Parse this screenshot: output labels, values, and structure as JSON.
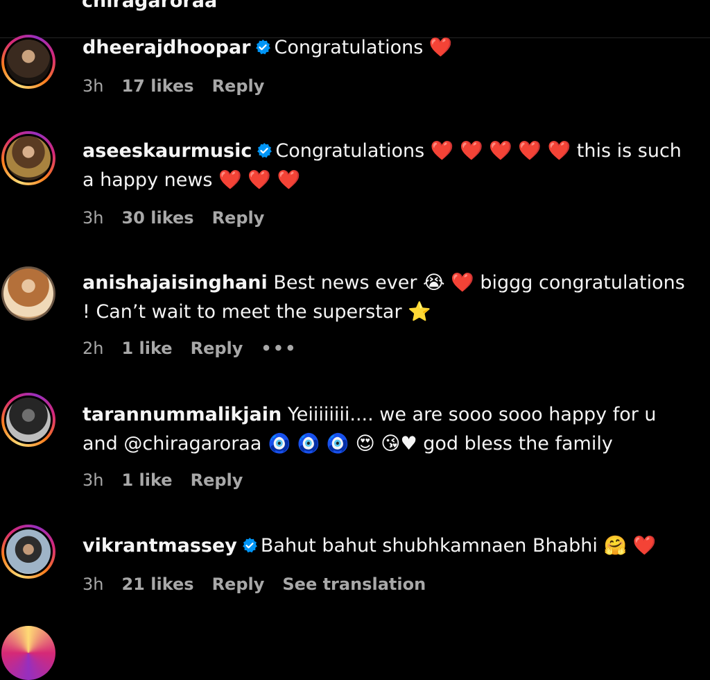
{
  "header": {
    "username": "chiragaroraa"
  },
  "comments": [
    {
      "username": "dheerajdhoopar",
      "text": "Congratulations ❤️",
      "time": "3h",
      "likes": "17 likes",
      "reply": "Reply"
    },
    {
      "username": "aseeskaurmusic",
      "text": "Congratulations ❤️ ❤️ ❤️ ❤️ ❤️  this is such a happy news ❤️ ❤️ ❤️",
      "time": "3h",
      "likes": "30 likes",
      "reply": "Reply"
    },
    {
      "username": "anishajaisinghani",
      "text": "Best news ever 😭 ❤️  biggg congratulations ! Can’t wait to meet the superstar ⭐",
      "time": "2h",
      "likes": "1 like",
      "reply": "Reply",
      "more": "•••"
    },
    {
      "username": "tarannummalikjain",
      "text": "Yeiiiiiiii.... we are sooo sooo happy for u and @chiragaroraa 🧿 🧿 🧿 😍 😘♥ god bless the family",
      "time": "3h",
      "likes": "1 like",
      "reply": "Reply"
    },
    {
      "username": "vikrantmassey",
      "text": "Bahut bahut shubhkamnaen Bhabhi 🤗 ❤️",
      "time": "3h",
      "likes": "21 likes",
      "reply": "Reply",
      "translate": "See translation"
    }
  ]
}
